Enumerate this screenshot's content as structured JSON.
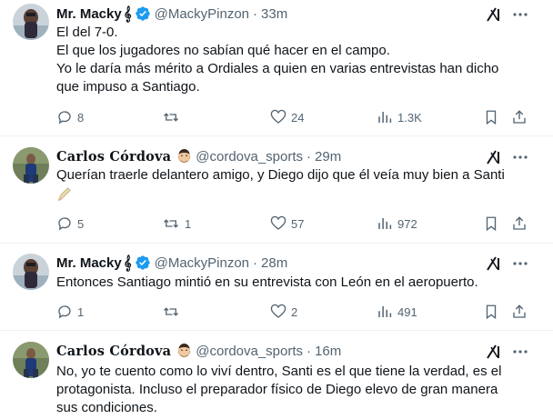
{
  "tweets": [
    {
      "display_name": "Mr. Macky",
      "name_suffix": "𝄞",
      "handle": "@MackyPinzon",
      "time": "33m",
      "lines": [
        "El del 7-0.",
        "El que los jugadores no sabían qué hacer en el campo.",
        "Yo le daría más mérito a Ordiales a quien en varias entrevistas han dicho",
        "que impuso a Santiago."
      ],
      "replies": "8",
      "reposts": "",
      "likes": "24",
      "views": "1.3K"
    },
    {
      "display_name": "Carlos Córdova",
      "handle": "@cordova_sports",
      "time": "29m",
      "lines": [
        "Querían traerle delantero amigo, y Diego dijo que él veía muy bien a Santi"
      ],
      "replies": "5",
      "reposts": "1",
      "likes": "57",
      "views": "972"
    },
    {
      "display_name": "Mr. Macky",
      "name_suffix": "𝄞",
      "handle": "@MackyPinzon",
      "time": "28m",
      "lines": [
        "Entonces Santiago mintió en su entrevista con León en el aeropuerto."
      ],
      "replies": "1",
      "reposts": "",
      "likes": "2",
      "views": "491"
    },
    {
      "display_name": "Carlos Córdova",
      "handle": "@cordova_sports",
      "time": "16m",
      "lines": [
        "No, yo te cuento como lo viví dentro, Santi es el que tiene  la verdad, es el",
        "protagonista. Incluso el preparador físico de Diego elevo de gran manera",
        "sus condiciones."
      ]
    }
  ],
  "separator": "·",
  "colors": {
    "text": "#0f1419",
    "secondary": "#536471",
    "verified": "#1d9bf0",
    "divider": "#eff3f4"
  },
  "icons": [
    "verified-badge-icon",
    "grok-icon",
    "more-icon",
    "reply-icon",
    "repost-icon",
    "like-icon",
    "views-icon",
    "bookmark-icon",
    "share-icon",
    "pencil-emoji-icon",
    "beard-emoji-icon"
  ]
}
